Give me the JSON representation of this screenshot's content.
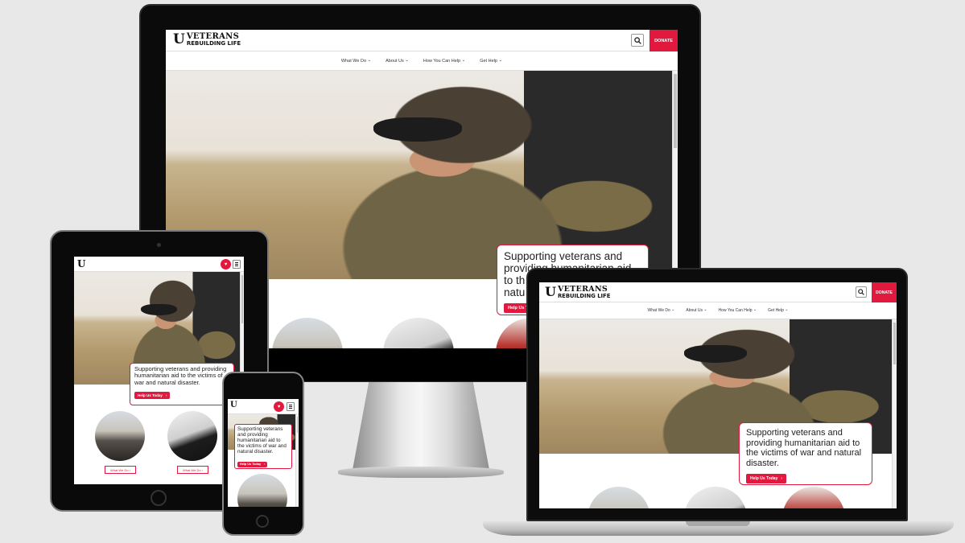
{
  "brand": {
    "mark": "U",
    "name_line1": "VETERANS",
    "name_line2": "REBUILDING LIFE",
    "accent": "#e1193e"
  },
  "header": {
    "donate_label": "DONATE",
    "search_icon": "search-icon",
    "menu_icon": "hamburger-icon"
  },
  "nav": {
    "items": [
      {
        "label": "What We Do"
      },
      {
        "label": "About Us"
      },
      {
        "label": "How You Can Help"
      },
      {
        "label": "Get Help"
      }
    ],
    "chevron": "⌄"
  },
  "hero": {
    "tagline": "Supporting veterans and providing humanitarian aid to the victims of war and natural disaster.",
    "tagline_monitor": "Supporting veterans and providing humanitarian aid to th… natu…",
    "cta_label": "Help Us Today",
    "cta_icon": "chevron-right-icon"
  },
  "cards": {
    "card1_button": "What We Do",
    "card2_button": "What We Do"
  }
}
